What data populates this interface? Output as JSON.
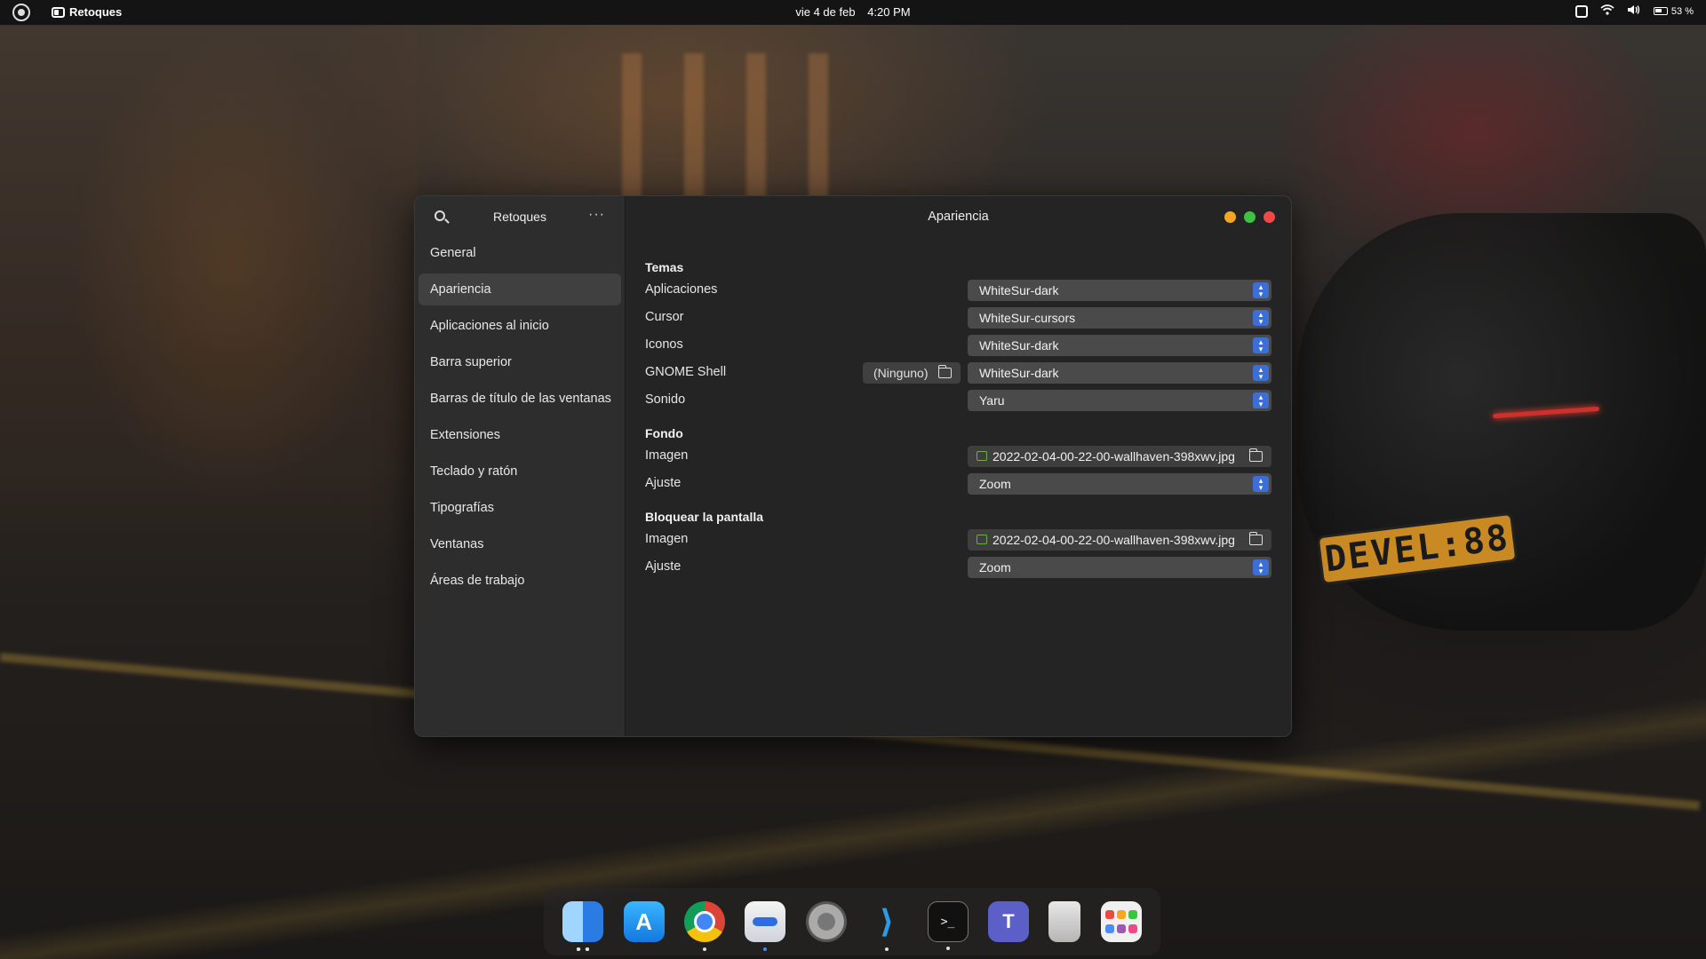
{
  "topbar": {
    "app_name": "Retoques",
    "date": "vie  4 de feb",
    "time": "4:20 PM",
    "battery": "53 %"
  },
  "window": {
    "sidebar_title": "Retoques",
    "content_title": "Apariencia",
    "nav": [
      "General",
      "Apariencia",
      "Aplicaciones al inicio",
      "Barra superior",
      "Barras de título de las ventanas",
      "Extensiones",
      "Teclado y ratón",
      "Tipografías",
      "Ventanas",
      "Áreas de trabajo"
    ],
    "active_nav": "Apariencia"
  },
  "themes": {
    "title": "Temas",
    "apps_label": "Aplicaciones",
    "apps_value": "WhiteSur-dark",
    "cursor_label": "Cursor",
    "cursor_value": "WhiteSur-cursors",
    "icons_label": "Iconos",
    "icons_value": "WhiteSur-dark",
    "shell_label": "GNOME Shell",
    "shell_file": "(Ninguno)",
    "shell_value": "WhiteSur-dark",
    "sound_label": "Sonido",
    "sound_value": "Yaru"
  },
  "background": {
    "title": "Fondo",
    "image_label": "Imagen",
    "image_value": "2022-02-04-00-22-00-wallhaven-398xwv.jpg",
    "fit_label": "Ajuste",
    "fit_value": "Zoom"
  },
  "lockscreen": {
    "title": "Bloquear la pantalla",
    "image_label": "Imagen",
    "image_value": "2022-02-04-00-22-00-wallhaven-398xwv.jpg",
    "fit_label": "Ajuste",
    "fit_value": "Zoom"
  },
  "wallpaper": {
    "plate_text": "DEVEL:88"
  },
  "dock": {
    "items": [
      "finder-icon",
      "app-store-icon",
      "chrome-icon",
      "tweaks-icon",
      "settings-icon",
      "vscode-icon",
      "terminal-icon",
      "teams-icon",
      "trash-icon",
      "app-grid-icon"
    ],
    "terminal_glyph": ">_",
    "vscode_glyph": "⟩",
    "teams_glyph": "T",
    "appstore_glyph": "A"
  },
  "colors": {
    "accent": "#3c6fd6",
    "minimize": "#f4a623",
    "maximize": "#3ec341",
    "close": "#ef4848"
  }
}
